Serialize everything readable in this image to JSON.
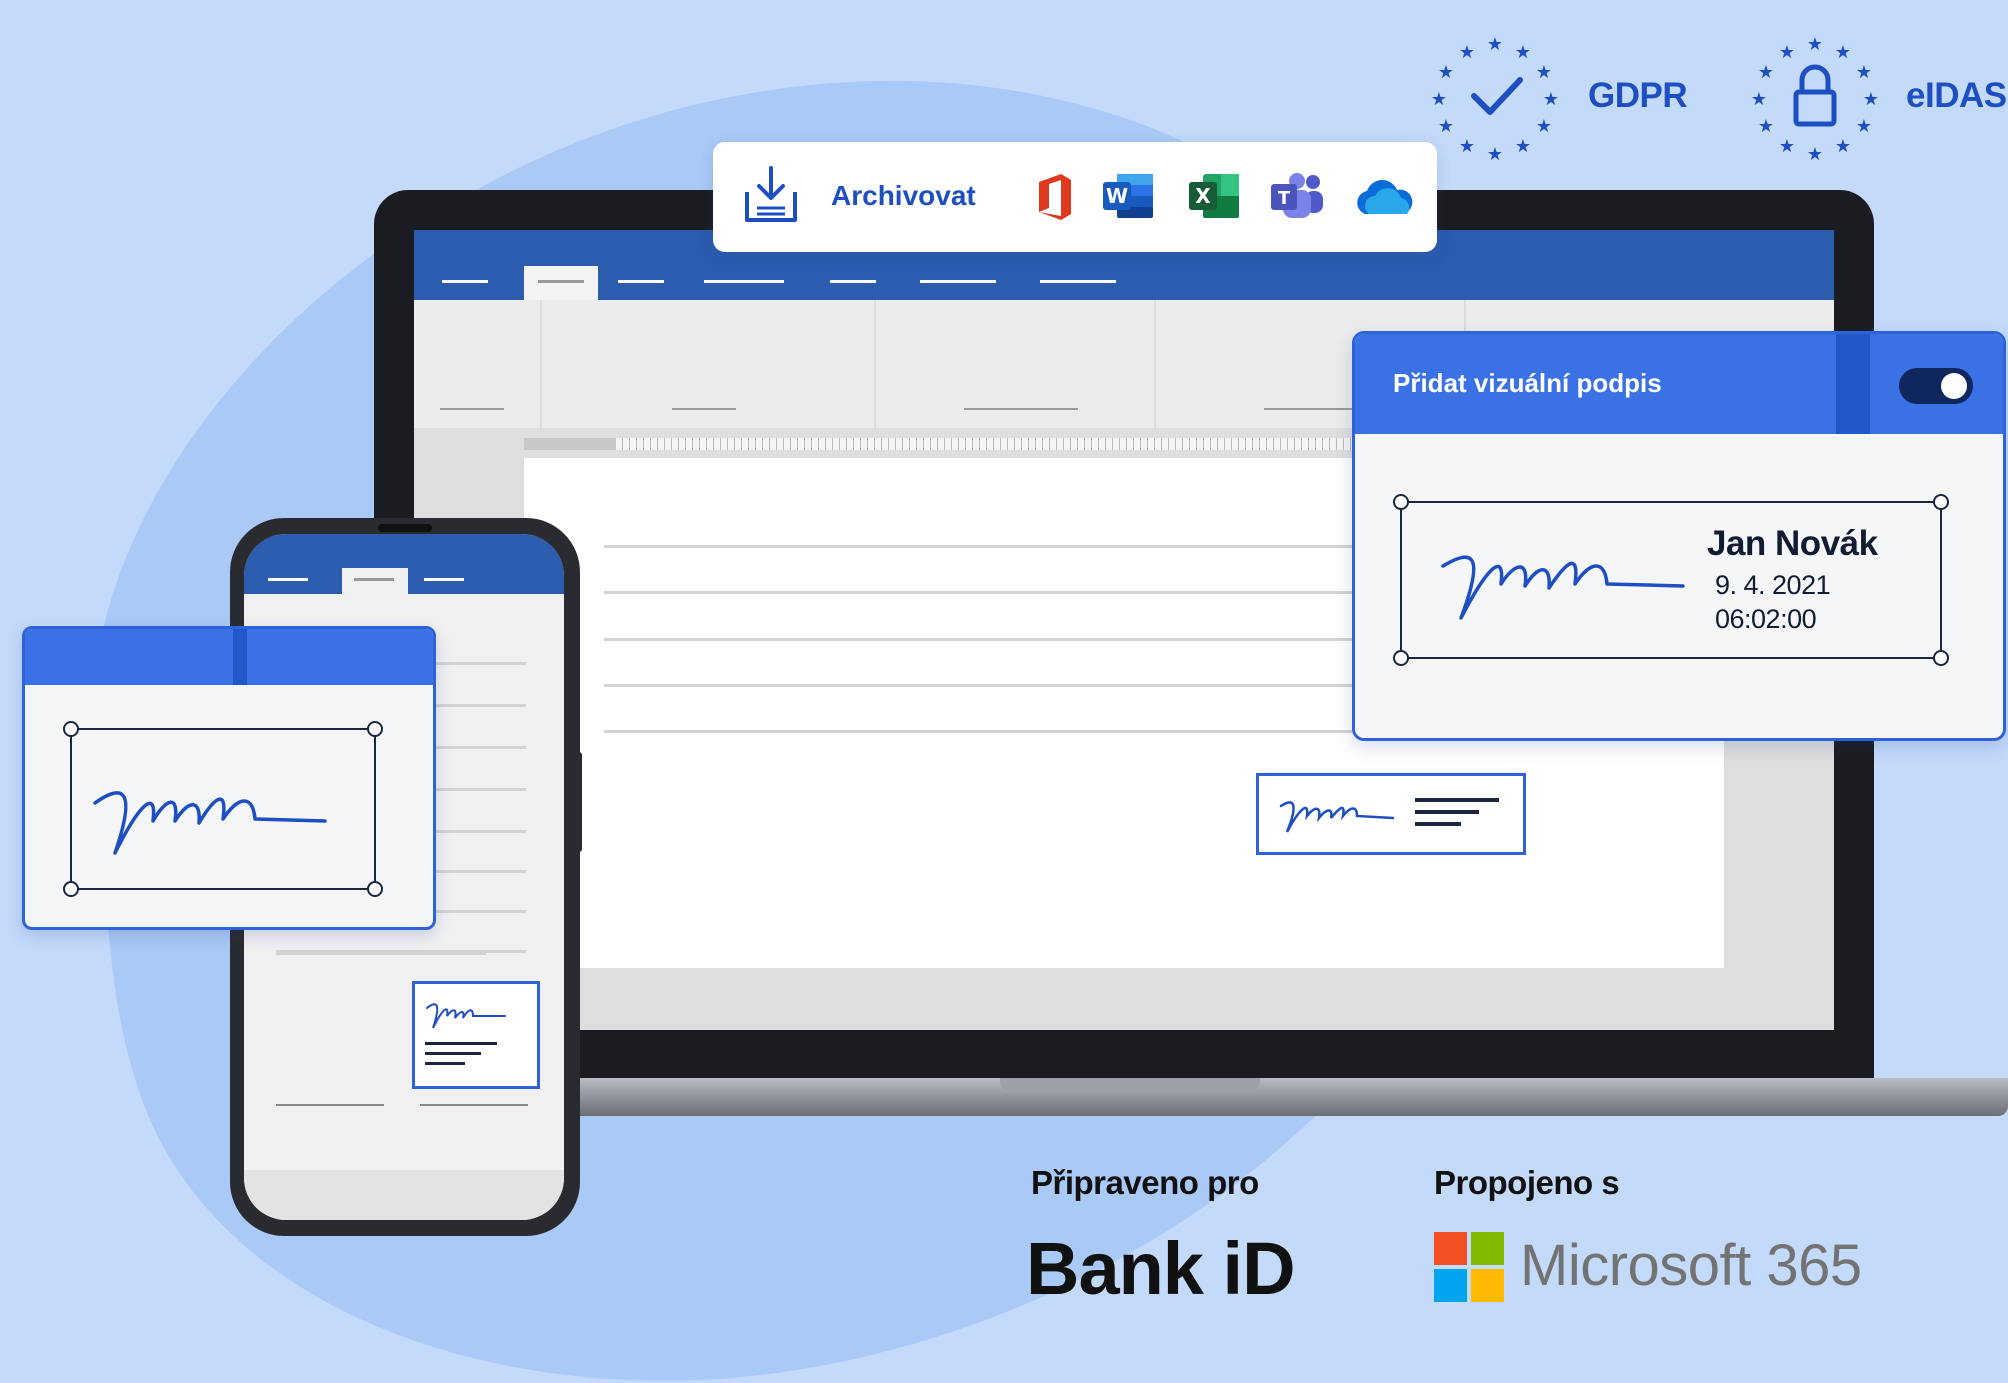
{
  "badges": {
    "gdpr": {
      "label": "GDPR",
      "icon": "eu-stars-check-icon"
    },
    "eidas": {
      "label": "eIDAS",
      "icon": "eu-stars-lock-icon"
    }
  },
  "toolbar": {
    "archive_label": "Archivovat",
    "archive_icon": "download-tray-icon",
    "apps": [
      "office-icon",
      "word-icon",
      "excel-icon",
      "teams-icon",
      "onedrive-icon"
    ]
  },
  "visual_signature_panel": {
    "title": "Přidat vizuální podpis",
    "toggle_on": true,
    "signer_name": "Jan Novák",
    "date": "9. 4. 2021",
    "time": "06:02:00"
  },
  "bottom": {
    "ready_for_label": "Připraveno pro",
    "ready_for_brand": "Bank iD",
    "connected_label": "Propojeno s",
    "connected_brand": "Microsoft 365"
  },
  "colors": {
    "background": "#c4dafb",
    "accent": "#2f62d9",
    "brand_blue": "#1e4fc2",
    "word_blue": "#2b5cae",
    "ms_red": "#f25022",
    "ms_green": "#7fba00",
    "ms_blue": "#00a4ef",
    "ms_yellow": "#ffb900"
  }
}
